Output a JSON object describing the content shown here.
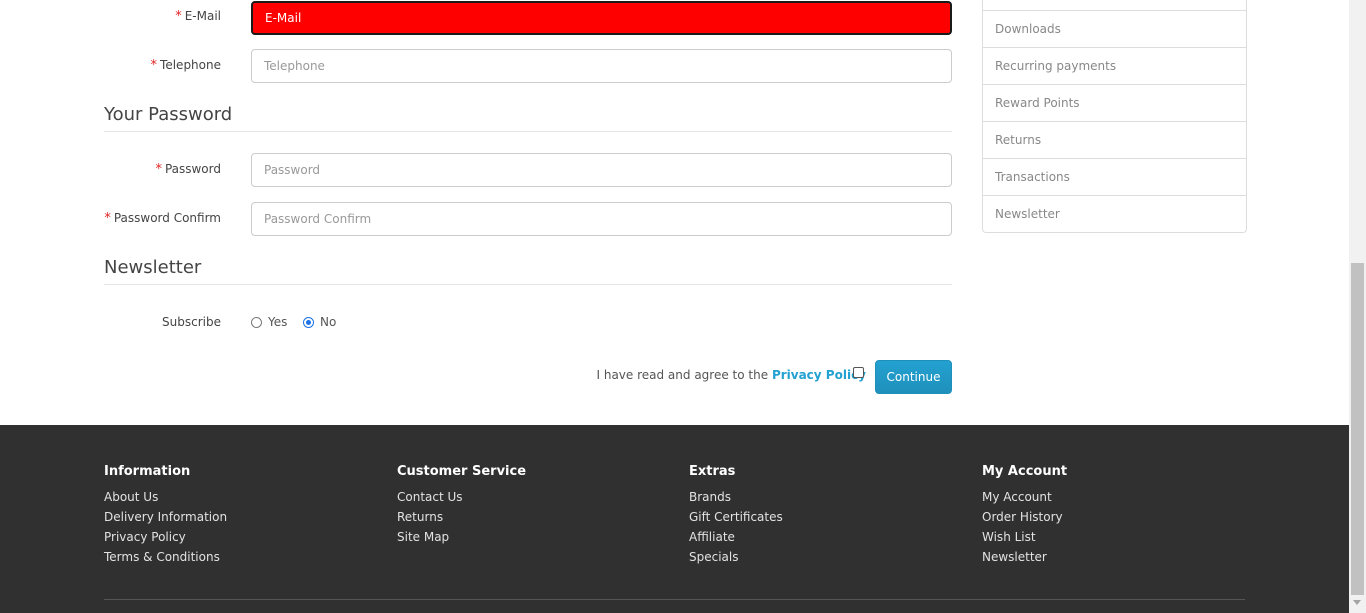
{
  "form": {
    "email": {
      "label": "E-Mail",
      "placeholder": "E-Mail"
    },
    "telephone": {
      "label": "Telephone",
      "placeholder": "Telephone"
    },
    "password_section": "Your Password",
    "password": {
      "label": "Password",
      "placeholder": "Password"
    },
    "password_confirm": {
      "label": "Password Confirm",
      "placeholder": "Password Confirm"
    },
    "newsletter_section": "Newsletter",
    "subscribe": {
      "label": "Subscribe",
      "yes": "Yes",
      "no": "No",
      "selected": "No"
    },
    "required_mark": "*",
    "agree_text": "I have read and agree to the",
    "agree_link": "Privacy Policy",
    "continue_label": "Continue"
  },
  "account_menu": {
    "items": [
      "",
      "Downloads",
      "Recurring payments",
      "Reward Points",
      "Returns",
      "Transactions",
      "Newsletter"
    ]
  },
  "footer": {
    "columns": [
      {
        "title": "Information",
        "links": [
          "About Us",
          "Delivery Information",
          "Privacy Policy",
          "Terms & Conditions"
        ]
      },
      {
        "title": "Customer Service",
        "links": [
          "Contact Us",
          "Returns",
          "Site Map"
        ]
      },
      {
        "title": "Extras",
        "links": [
          "Brands",
          "Gift Certificates",
          "Affiliate",
          "Specials"
        ]
      },
      {
        "title": "My Account",
        "links": [
          "My Account",
          "Order History",
          "Wish List",
          "Newsletter"
        ]
      }
    ]
  },
  "colors": {
    "error_field": "#ff0000",
    "accent": "#229ac8",
    "footer_bg": "#303030",
    "required": "#e12121"
  }
}
